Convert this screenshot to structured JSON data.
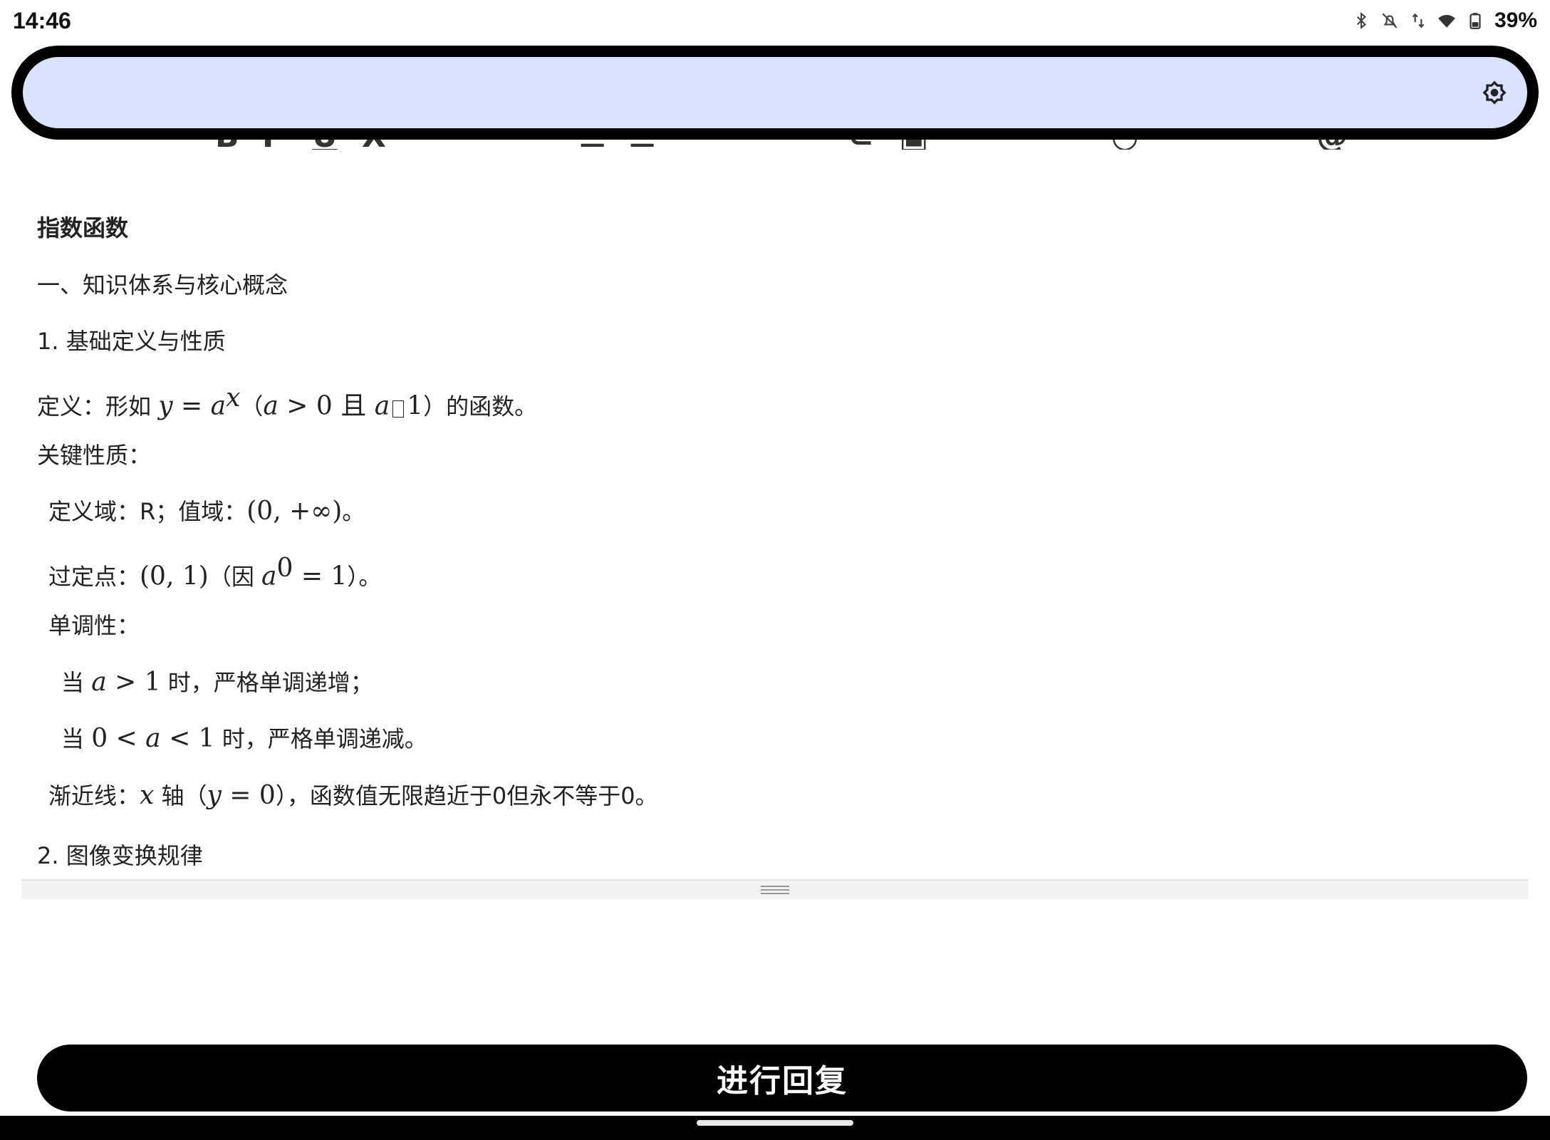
{
  "status_bar": {
    "time": "14:46",
    "battery": "39%",
    "icons": [
      "bluetooth-icon",
      "bell-off-icon",
      "data-arrows-icon",
      "wifi-icon",
      "battery-icon"
    ]
  },
  "floating_bar": {
    "color": "#d9e3ff",
    "settings_icon": "settings-icon"
  },
  "content": {
    "title": "指数函数",
    "section1": "一、知识体系与核心概念",
    "sub1": "1. 基础定义与性质",
    "definition": {
      "label": "定义：形如 ",
      "y": "y",
      "eq": " = ",
      "a": "a",
      "x": "x",
      "cond_open": "（",
      "cond_a": "a",
      "cond_gt": " > 0 且 ",
      "cond_a2": "a",
      "cond_one": "1",
      "tail": "）的函数。"
    },
    "key_props": "关键性质：",
    "domain": {
      "label": "定义域：R；值域：",
      "interval": "(0, +∞)",
      "tail": "。"
    },
    "fixed_point": {
      "label": "过定点：",
      "point": "(0, 1)",
      "because": "（因 ",
      "a": "a",
      "zero": "0",
      "eq": " = 1",
      "tail": "）。"
    },
    "monotonic": "单调性：",
    "case1": {
      "pre": "当 ",
      "a": "a",
      "cond": " > 1",
      "tail": " 时，严格单调递增；"
    },
    "case2": {
      "pre": "当 ",
      "zero": "0 < ",
      "a": "a",
      "cond": " < 1",
      "tail": " 时，严格单调递减。"
    },
    "asymptote": {
      "label": "渐近线：",
      "x": "x",
      "axis": " 轴（",
      "y": "y",
      "eq": " = 0",
      "tail": "），函数值无限趋近于0但永不等于0。"
    },
    "sub2": "2. 图像变换规律"
  },
  "reply_button": "进行回复"
}
